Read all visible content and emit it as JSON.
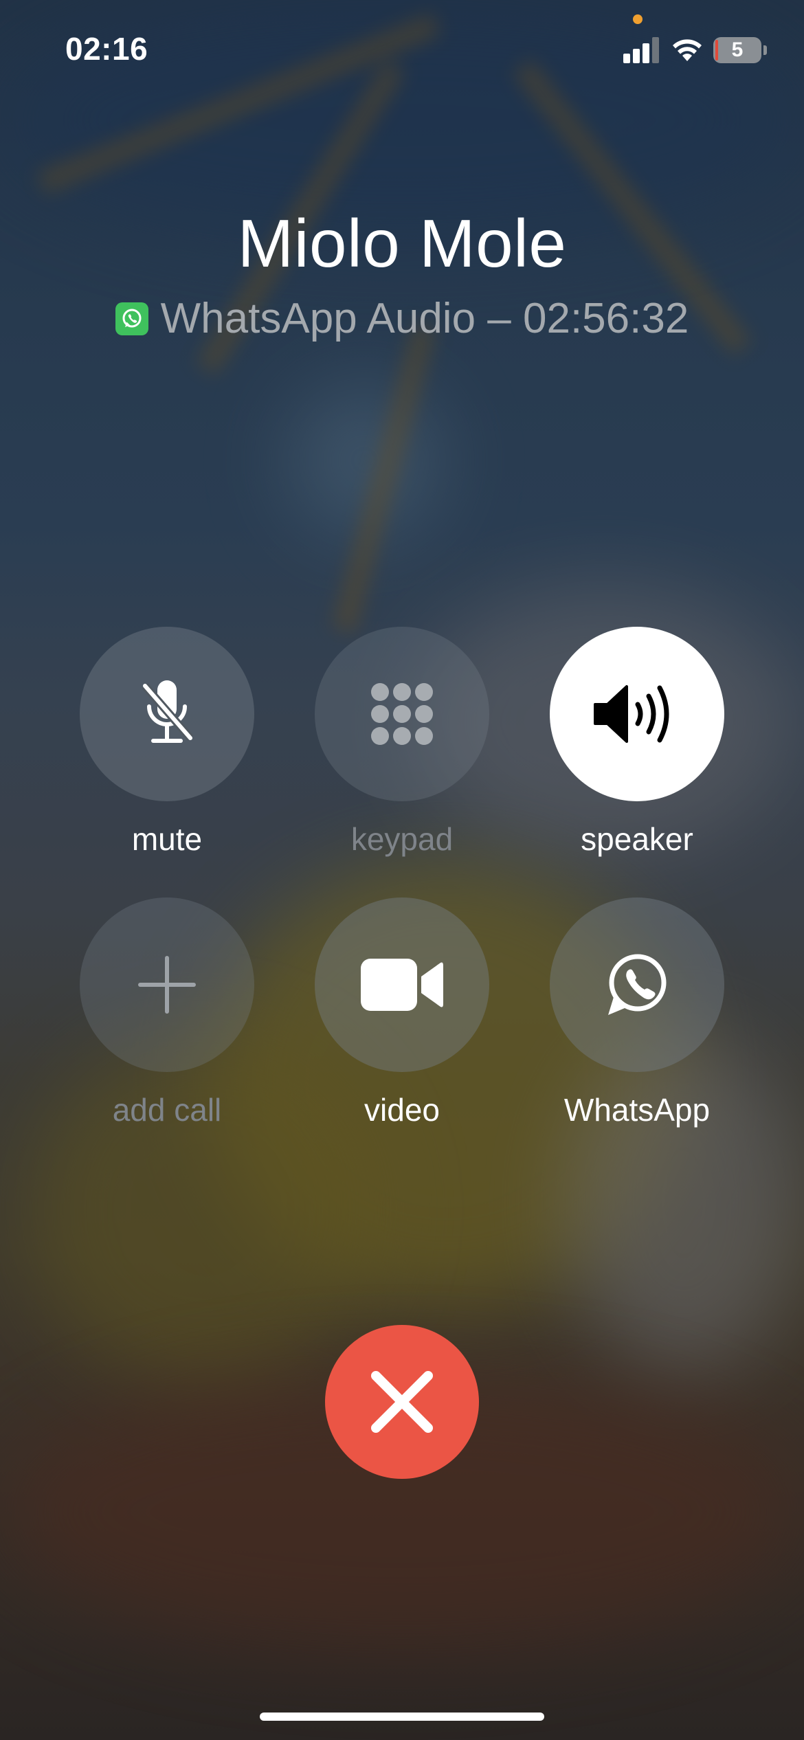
{
  "status_bar": {
    "time": "02:16",
    "battery_level": "5",
    "signal_bars_active": 3,
    "signal_bars_total": 4,
    "icons": [
      "signal-icon",
      "wifi-icon",
      "battery-icon"
    ]
  },
  "call": {
    "name": "Miolo Mole",
    "subtitle": "WhatsApp Audio – 02:56:32",
    "app_icon": "whatsapp-icon"
  },
  "controls": {
    "mute": {
      "label": "mute",
      "icon": "microphone-slash-icon",
      "enabled": true,
      "active": false
    },
    "keypad": {
      "label": "keypad",
      "icon": "keypad-icon",
      "enabled": false,
      "active": false
    },
    "speaker": {
      "label": "speaker",
      "icon": "speaker-icon",
      "enabled": true,
      "active": true
    },
    "add_call": {
      "label": "add call",
      "icon": "plus-icon",
      "enabled": false,
      "active": false
    },
    "video": {
      "label": "video",
      "icon": "video-camera-icon",
      "enabled": true,
      "active": false
    },
    "whatsapp": {
      "label": "WhatsApp",
      "icon": "whatsapp-icon",
      "enabled": true,
      "active": false
    }
  },
  "end_call": {
    "icon": "close-icon",
    "color": "#eb5545"
  },
  "colors": {
    "end_call_red": "#eb5545",
    "whatsapp_green": "#3fc15d",
    "active_button": "#ffffff",
    "dim_label": "#7f848a"
  }
}
